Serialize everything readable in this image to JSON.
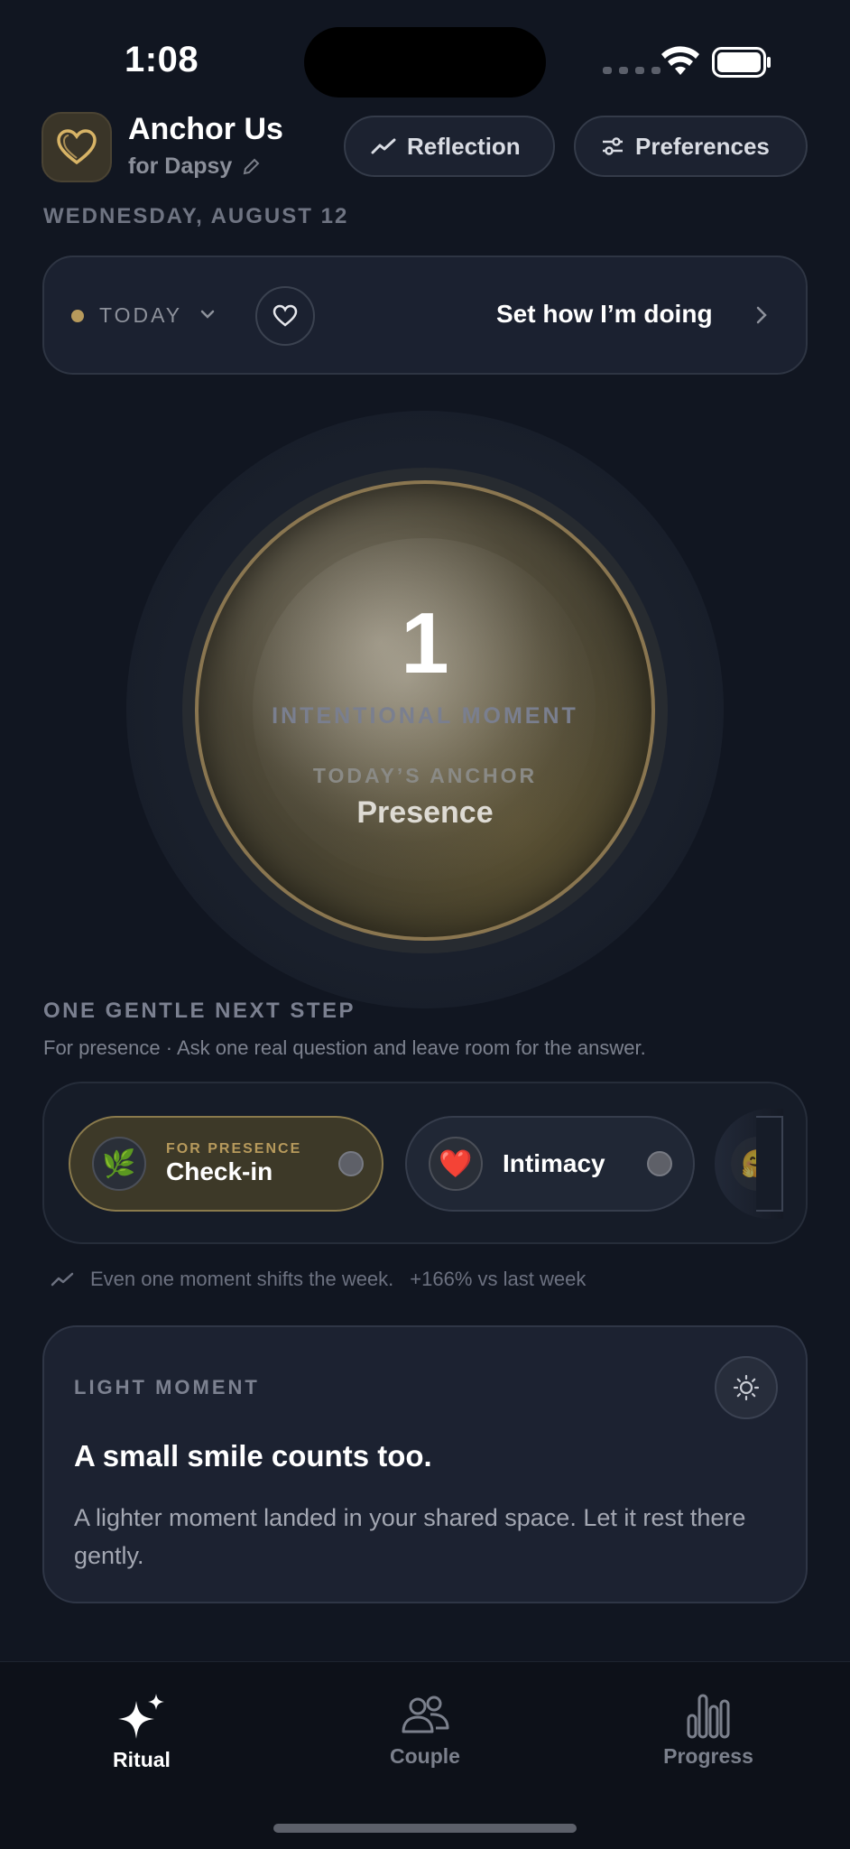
{
  "status_bar": {
    "time": "1:08"
  },
  "header": {
    "app_title": "Anchor Us",
    "subtitle": "for Dapsy",
    "reflection_label": "Reflection",
    "preferences_label": "Preferences"
  },
  "date": "WEDNESDAY, AUGUST 12",
  "today_card": {
    "label": "TODAY",
    "action_label": "Set how I’m doing"
  },
  "hero": {
    "count": "1",
    "count_label": "INTENTIONAL MOMENT",
    "anchor_label": "TODAY’S ANCHOR",
    "anchor_value": "Presence"
  },
  "next_step": {
    "title": "ONE GENTLE NEXT STEP",
    "subtitle": "For presence · Ask one real question and leave room for the answer.",
    "chips": [
      {
        "kicker": "FOR PRESENCE",
        "label": "Check-in",
        "icon": "leaf-icon",
        "emoji": "🌿"
      },
      {
        "label": "Intimacy",
        "icon": "heart-icon",
        "emoji": "❤️"
      },
      {
        "icon": "hug-icon",
        "emoji": "🤗"
      }
    ]
  },
  "trend": {
    "text": "Even one moment shifts the week.",
    "change": "+166% vs last week"
  },
  "light_moment": {
    "kicker": "LIGHT MOMENT",
    "title": "A small smile counts too.",
    "body": "A lighter moment landed in your shared space. Let it rest there gently."
  },
  "tabs": [
    {
      "label": "Ritual",
      "active": true
    },
    {
      "label": "Couple",
      "active": false
    },
    {
      "label": "Progress",
      "active": false
    }
  ],
  "colors": {
    "background": "#111621",
    "accent_gold": "#b79a5c",
    "card": "#1b2130"
  }
}
